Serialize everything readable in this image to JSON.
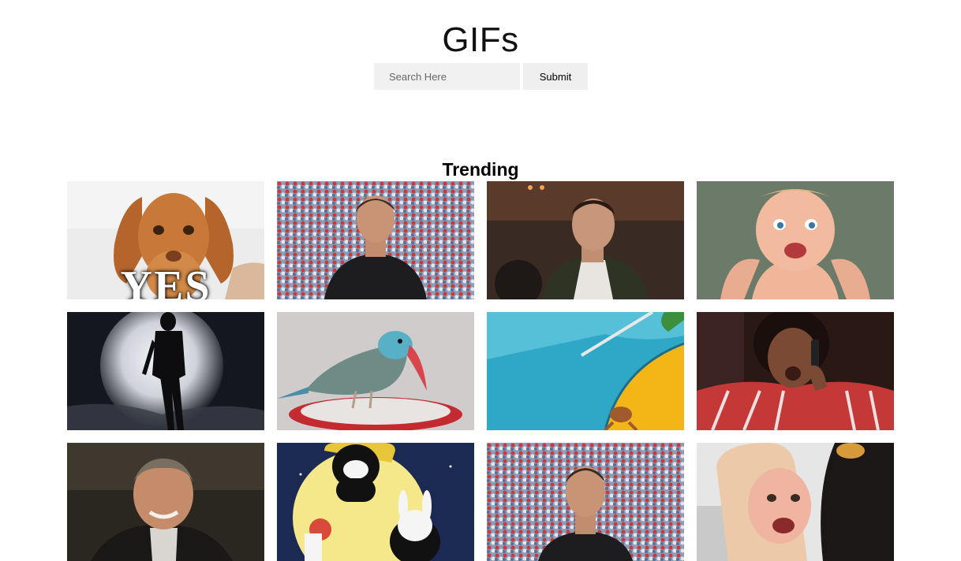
{
  "header": {
    "title": "GIFs"
  },
  "search": {
    "placeholder": "Search Here",
    "value": "",
    "submit_label": "Submit"
  },
  "trending": {
    "heading": "Trending",
    "gifs": [
      {
        "subject": "puppy",
        "caption": "YES"
      },
      {
        "subject": "man-in-stadium"
      },
      {
        "subject": "man-in-jacket"
      },
      {
        "subject": "laughing-baby"
      },
      {
        "subject": "woman-in-moonlight"
      },
      {
        "subject": "parrot"
      },
      {
        "subject": "cartoon-umbrella"
      },
      {
        "subject": "woman-on-phone"
      },
      {
        "subject": "grinning-man"
      },
      {
        "subject": "cartoon-bears"
      },
      {
        "subject": "man-in-stadium"
      },
      {
        "subject": "costume-man"
      }
    ]
  },
  "colors": {
    "page_background": "#ffffff",
    "input_background": "#f1f1f1",
    "button_background": "#efefef"
  }
}
